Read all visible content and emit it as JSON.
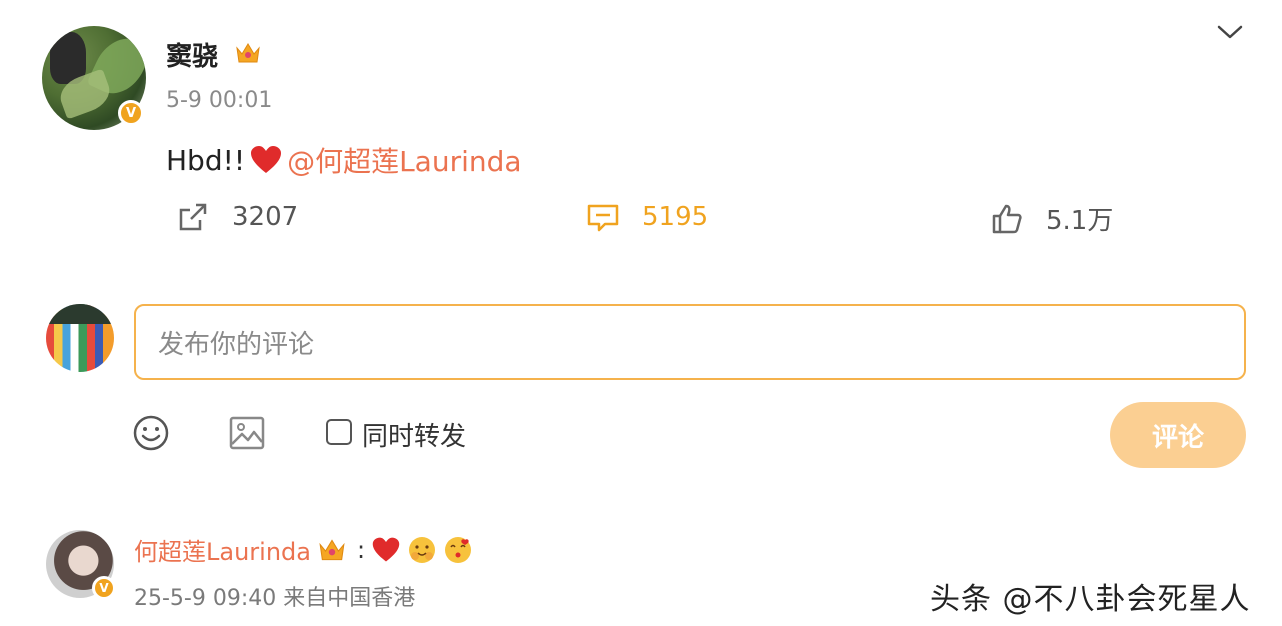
{
  "post": {
    "username": "窦骁",
    "timestamp": "5-9 00:01",
    "text_prefix": "Hbd!! ",
    "mention": "@何超莲Laurinda",
    "badge_letter": "V",
    "actions": {
      "repost_count": "3207",
      "comment_count": "5195",
      "like_count": "5.1万"
    }
  },
  "composer": {
    "placeholder": "发布你的评论",
    "also_repost_label": "同时转发",
    "submit_label": "评论"
  },
  "reply": {
    "username": "何超莲Laurinda",
    "colon": ":",
    "meta": "25-5-9 09:40 来自中国香港",
    "badge_letter": "V"
  },
  "watermark": "头条 @不八卦会死星人",
  "colors": {
    "accent": "#eb7350",
    "badge": "#f0a31f",
    "input_border": "#f5b24c",
    "submit_bg": "#fbcf92"
  },
  "icons": [
    "crown-icon",
    "chevron-down-icon",
    "heart-icon",
    "repost-icon",
    "comment-icon",
    "like-icon",
    "smile-icon",
    "image-icon",
    "verified-badge-icon"
  ]
}
